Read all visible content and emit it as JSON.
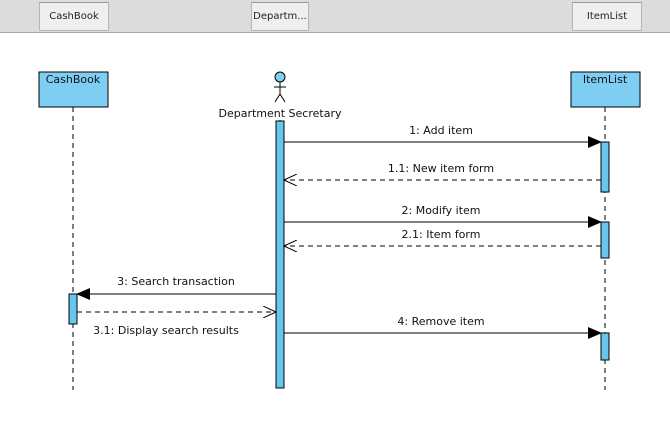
{
  "tabs": [
    {
      "label": "CashBook"
    },
    {
      "label": "Departm..."
    },
    {
      "label": "ItemList"
    }
  ],
  "lifelines": {
    "cashbook": {
      "label": "CashBook"
    },
    "secretary": {
      "label": "Department Secretary"
    },
    "itemlist": {
      "label": "ItemList"
    }
  },
  "messages": [
    {
      "label": "1: Add item"
    },
    {
      "label": "1.1: New item form"
    },
    {
      "label": "2: Modify item"
    },
    {
      "label": "2.1: Item form"
    },
    {
      "label": "3: Search transaction"
    },
    {
      "label": "3.1: Display search results"
    },
    {
      "label": "4: Remove item"
    }
  ],
  "colors": {
    "box_fill": "#7ecef4",
    "activation_fill": "#66c6ee",
    "line": "#000000"
  }
}
